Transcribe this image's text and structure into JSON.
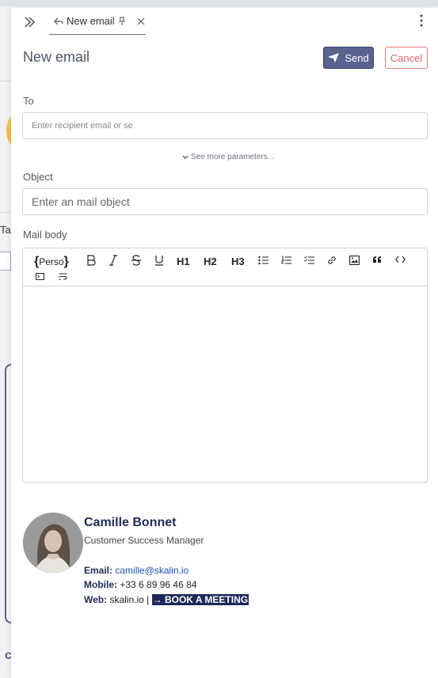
{
  "tab": {
    "label": "New email"
  },
  "header": {
    "title": "New email",
    "send_label": "Send",
    "cancel_label": "Cancel"
  },
  "background": {
    "tag_label": "Tag"
  },
  "form": {
    "to_label": "To",
    "to_placeholder": "Enter recipient email or se",
    "more_params": "See more parameters...",
    "object_label": "Object",
    "object_placeholder": "Enter an mail object",
    "body_label": "Mail body"
  },
  "toolbar": {
    "perso_label": "Perso",
    "h1": "H1",
    "h2": "H2",
    "h3": "H3",
    "icons": [
      "bold-icon",
      "italic-icon",
      "strikethrough-icon",
      "underline-icon",
      "bullet-list-icon",
      "numbered-list-icon",
      "checklist-icon",
      "link-icon",
      "image-icon",
      "quote-icon",
      "code-icon",
      "code-block-icon",
      "wrap-icon"
    ]
  },
  "signature": {
    "name": "Camille Bonnet",
    "role": "Customer Success Manager",
    "email_label": "Email:",
    "email": "camille@skalin.io",
    "mobile_label": "Mobile:",
    "mobile": "+33 6 89 96 46 84",
    "web_label": "Web:",
    "web": "skalin.io",
    "separator": "|",
    "book_meeting": "→ BOOK A MEETING"
  },
  "colors": {
    "send": "#5a6290",
    "cancel": "#e06666",
    "signature_name": "#1f2a5a",
    "link": "#1a4fb0"
  }
}
